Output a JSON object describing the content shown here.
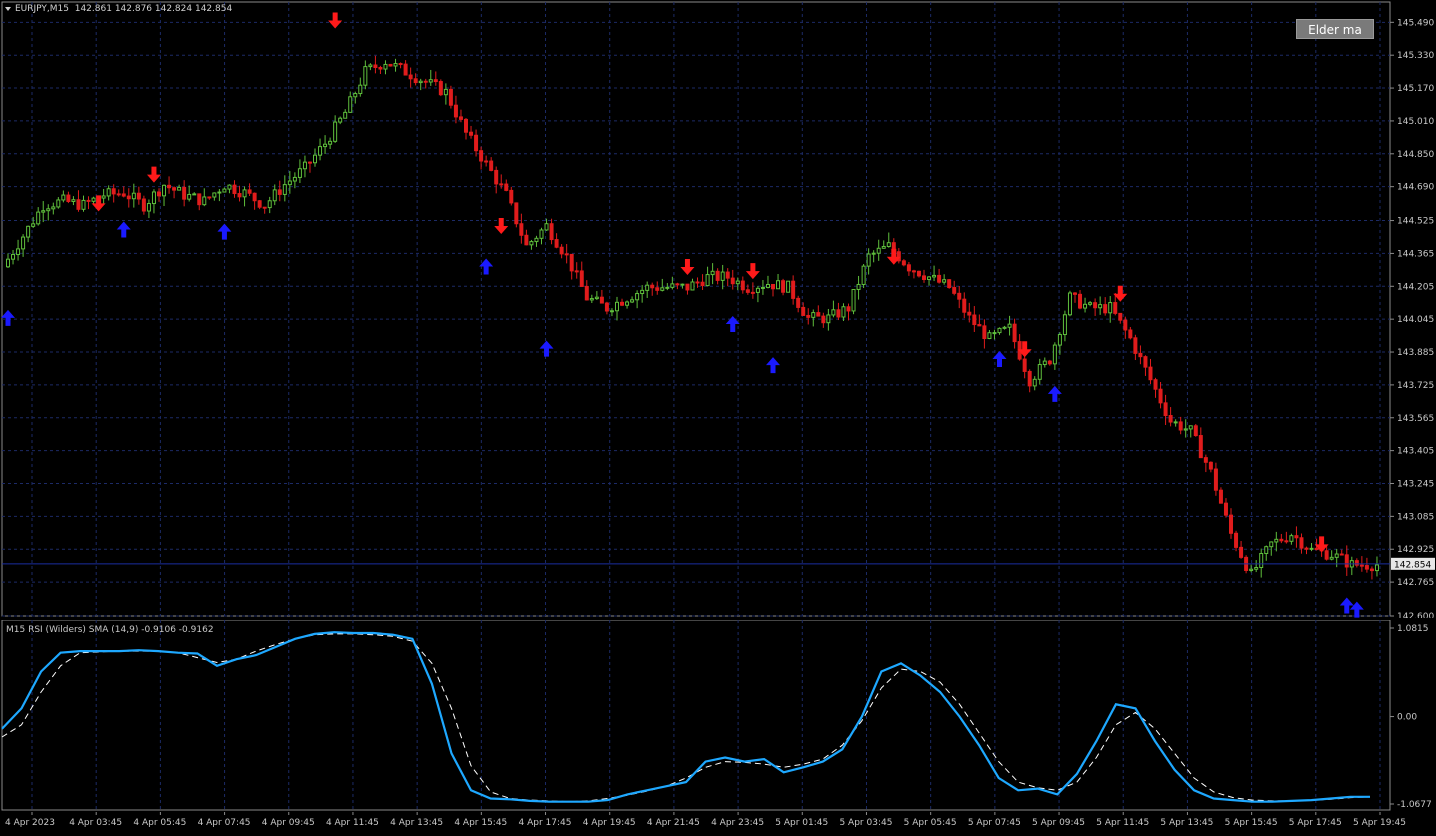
{
  "header": {
    "symbol": "EURJPY,M15",
    "ohlc": "142.861 142.876 142.824 142.854"
  },
  "button": {
    "label": "Elder ma"
  },
  "indicator": {
    "title": "M15 RSI (Wilders) SMA (14,9) -0.9106 -0.9162"
  },
  "colors": {
    "background": "#000000",
    "grid": "#1c2a66",
    "bull_candle": "#5fbf3c",
    "bear_candle": "#e01c1c",
    "buy_arrow": "#1a1aff",
    "sell_arrow": "#ff1a1a",
    "rsi_line": "#1ea8ff",
    "signal_line": "#ffffff",
    "price_line": "#1a2ea0"
  },
  "price_axis": {
    "labels": [
      "145.490",
      "145.330",
      "145.170",
      "145.010",
      "144.850",
      "144.690",
      "144.525",
      "144.365",
      "144.205",
      "144.045",
      "143.885",
      "143.725",
      "143.565",
      "143.405",
      "143.245",
      "143.085",
      "142.925",
      "142.765",
      "142.600"
    ],
    "current_price": "142.854"
  },
  "indicator_axis": {
    "labels": [
      "1.0815",
      "0.00",
      "-1.0677"
    ]
  },
  "time_axis": {
    "labels": [
      "4 Apr 2023",
      "4 Apr 03:45",
      "4 Apr 05:45",
      "4 Apr 07:45",
      "4 Apr 09:45",
      "4 Apr 11:45",
      "4 Apr 13:45",
      "4 Apr 15:45",
      "4 Apr 17:45",
      "4 Apr 19:45",
      "4 Apr 21:45",
      "4 Apr 23:45",
      "5 Apr 01:45",
      "5 Apr 03:45",
      "5 Apr 05:45",
      "5 Apr 07:45",
      "5 Apr 09:45",
      "5 Apr 11:45",
      "5 Apr 13:45",
      "5 Apr 15:45",
      "5 Apr 17:45",
      "5 Apr 19:45"
    ]
  },
  "chart_data": [
    {
      "type": "candlestick",
      "symbol": "EURJPY",
      "timeframe": "M15",
      "ylim": [
        142.6,
        145.55
      ],
      "price_line": 142.854,
      "close_path": [
        [
          0,
          144.3
        ],
        [
          4,
          144.45
        ],
        [
          8,
          144.6
        ],
        [
          12,
          144.62
        ],
        [
          16,
          144.6
        ],
        [
          20,
          144.65
        ],
        [
          24,
          144.66
        ],
        [
          28,
          144.6
        ],
        [
          32,
          144.7
        ],
        [
          36,
          144.65
        ],
        [
          40,
          144.62
        ],
        [
          44,
          144.7
        ],
        [
          48,
          144.66
        ],
        [
          52,
          144.6
        ],
        [
          56,
          144.7
        ],
        [
          60,
          144.78
        ],
        [
          64,
          144.9
        ],
        [
          68,
          145.05
        ],
        [
          72,
          145.25
        ],
        [
          76,
          145.3
        ],
        [
          80,
          145.25
        ],
        [
          84,
          145.2
        ],
        [
          88,
          145.15
        ],
        [
          92,
          144.95
        ],
        [
          96,
          144.8
        ],
        [
          100,
          144.65
        ],
        [
          104,
          144.4
        ],
        [
          108,
          144.5
        ],
        [
          112,
          144.35
        ],
        [
          116,
          144.15
        ],
        [
          120,
          144.1
        ],
        [
          124,
          144.15
        ],
        [
          128,
          144.2
        ],
        [
          132,
          144.2
        ],
        [
          136,
          144.2
        ],
        [
          140,
          144.25
        ],
        [
          144,
          144.25
        ],
        [
          148,
          144.2
        ],
        [
          152,
          144.22
        ],
        [
          156,
          144.2
        ],
        [
          160,
          144.05
        ],
        [
          164,
          144.05
        ],
        [
          168,
          144.1
        ],
        [
          172,
          144.35
        ],
        [
          176,
          144.4
        ],
        [
          180,
          144.3
        ],
        [
          184,
          144.25
        ],
        [
          188,
          144.2
        ],
        [
          192,
          144.05
        ],
        [
          196,
          143.95
        ],
        [
          200,
          144.0
        ],
        [
          204,
          143.75
        ],
        [
          208,
          143.85
        ],
        [
          212,
          144.15
        ],
        [
          216,
          144.1
        ],
        [
          220,
          144.1
        ],
        [
          224,
          143.95
        ],
        [
          228,
          143.75
        ],
        [
          232,
          143.55
        ],
        [
          236,
          143.5
        ],
        [
          240,
          143.3
        ],
        [
          244,
          143.0
        ],
        [
          248,
          142.8
        ],
        [
          252,
          142.95
        ],
        [
          256,
          143.0
        ],
        [
          260,
          142.92
        ],
        [
          264,
          142.9
        ],
        [
          268,
          142.85
        ],
        [
          272,
          142.85
        ]
      ],
      "signals": {
        "buy_bars": [
          0,
          23,
          43,
          95,
          107,
          144,
          152,
          197,
          208,
          268,
          266
        ],
        "sell_bars": [
          18,
          29,
          65,
          98,
          135,
          148,
          176,
          202,
          221,
          261
        ],
        "buy_price_levels": [
          144.1,
          144.53,
          144.52,
          144.35,
          143.95,
          144.07,
          143.87,
          143.9,
          143.73,
          142.68,
          142.7
        ],
        "sell_price_levels": [
          144.56,
          144.7,
          145.45,
          144.45,
          144.25,
          144.23,
          144.3,
          143.85,
          144.12,
          142.9
        ]
      }
    },
    {
      "type": "line",
      "title": "M15 RSI (Wilders) SMA (14,9)",
      "ylim": [
        -1.0677,
        1.0815
      ],
      "series": [
        {
          "name": "RSI (Wilders)",
          "points": [
            [
              0,
              -0.15
            ],
            [
              3,
              0.1
            ],
            [
              6,
              0.55
            ],
            [
              9,
              0.78
            ],
            [
              12,
              0.8
            ],
            [
              15,
              0.8
            ],
            [
              18,
              0.8
            ],
            [
              21,
              0.81
            ],
            [
              24,
              0.8
            ],
            [
              27,
              0.78
            ],
            [
              30,
              0.77
            ],
            [
              33,
              0.62
            ],
            [
              36,
              0.7
            ],
            [
              39,
              0.75
            ],
            [
              42,
              0.85
            ],
            [
              45,
              0.95
            ],
            [
              48,
              1.01
            ],
            [
              51,
              1.03
            ],
            [
              54,
              1.02
            ],
            [
              57,
              1.02
            ],
            [
              60,
              1.0
            ],
            [
              63,
              0.95
            ],
            [
              66,
              0.4
            ],
            [
              69,
              -0.45
            ],
            [
              72,
              -0.9
            ],
            [
              75,
              -1.0
            ],
            [
              78,
              -1.01
            ],
            [
              81,
              -1.03
            ],
            [
              84,
              -1.04
            ],
            [
              87,
              -1.04
            ],
            [
              90,
              -1.04
            ],
            [
              93,
              -1.02
            ],
            [
              96,
              -0.95
            ],
            [
              99,
              -0.9
            ],
            [
              102,
              -0.85
            ],
            [
              105,
              -0.8
            ],
            [
              108,
              -0.55
            ],
            [
              111,
              -0.5
            ],
            [
              114,
              -0.55
            ],
            [
              117,
              -0.52
            ],
            [
              120,
              -0.68
            ],
            [
              123,
              -0.62
            ],
            [
              126,
              -0.55
            ],
            [
              129,
              -0.4
            ],
            [
              132,
              0.0
            ],
            [
              135,
              0.55
            ],
            [
              138,
              0.65
            ],
            [
              141,
              0.5
            ],
            [
              144,
              0.3
            ],
            [
              147,
              0.0
            ],
            [
              150,
              -0.35
            ],
            [
              153,
              -0.75
            ],
            [
              156,
              -0.9
            ],
            [
              159,
              -0.88
            ],
            [
              162,
              -0.95
            ],
            [
              165,
              -0.7
            ],
            [
              168,
              -0.3
            ],
            [
              171,
              0.15
            ],
            [
              174,
              0.1
            ],
            [
              177,
              -0.3
            ],
            [
              180,
              -0.65
            ],
            [
              183,
              -0.9
            ],
            [
              186,
              -1.0
            ],
            [
              189,
              -1.02
            ],
            [
              192,
              -1.04
            ],
            [
              195,
              -1.04
            ],
            [
              198,
              -1.03
            ],
            [
              201,
              -1.02
            ],
            [
              204,
              -1.0
            ],
            [
              207,
              -0.98
            ],
            [
              210,
              -0.98
            ]
          ]
        },
        {
          "name": "SMA",
          "points": [
            [
              0,
              -0.25
            ],
            [
              3,
              -0.1
            ],
            [
              6,
              0.3
            ],
            [
              9,
              0.62
            ],
            [
              12,
              0.78
            ],
            [
              15,
              0.79
            ],
            [
              18,
              0.8
            ],
            [
              21,
              0.8
            ],
            [
              24,
              0.8
            ],
            [
              27,
              0.78
            ],
            [
              30,
              0.72
            ],
            [
              33,
              0.66
            ],
            [
              36,
              0.7
            ],
            [
              39,
              0.8
            ],
            [
              42,
              0.88
            ],
            [
              45,
              0.95
            ],
            [
              48,
              1.0
            ],
            [
              51,
              1.01
            ],
            [
              54,
              1.01
            ],
            [
              57,
              1.0
            ],
            [
              60,
              0.98
            ],
            [
              63,
              0.92
            ],
            [
              66,
              0.65
            ],
            [
              69,
              0.1
            ],
            [
              72,
              -0.6
            ],
            [
              75,
              -0.92
            ],
            [
              78,
              -1.0
            ],
            [
              81,
              -1.02
            ],
            [
              84,
              -1.03
            ],
            [
              87,
              -1.04
            ],
            [
              90,
              -1.03
            ],
            [
              93,
              -1.0
            ],
            [
              96,
              -0.96
            ],
            [
              99,
              -0.91
            ],
            [
              102,
              -0.85
            ],
            [
              105,
              -0.75
            ],
            [
              108,
              -0.62
            ],
            [
              111,
              -0.55
            ],
            [
              114,
              -0.56
            ],
            [
              117,
              -0.58
            ],
            [
              120,
              -0.62
            ],
            [
              123,
              -0.58
            ],
            [
              126,
              -0.52
            ],
            [
              129,
              -0.35
            ],
            [
              132,
              -0.05
            ],
            [
              135,
              0.35
            ],
            [
              138,
              0.58
            ],
            [
              141,
              0.55
            ],
            [
              144,
              0.42
            ],
            [
              147,
              0.15
            ],
            [
              150,
              -0.2
            ],
            [
              153,
              -0.55
            ],
            [
              156,
              -0.8
            ],
            [
              159,
              -0.87
            ],
            [
              162,
              -0.9
            ],
            [
              165,
              -0.8
            ],
            [
              168,
              -0.5
            ],
            [
              171,
              -0.1
            ],
            [
              174,
              0.05
            ],
            [
              177,
              -0.15
            ],
            [
              180,
              -0.45
            ],
            [
              183,
              -0.75
            ],
            [
              186,
              -0.92
            ],
            [
              189,
              -0.99
            ],
            [
              192,
              -1.02
            ],
            [
              195,
              -1.03
            ],
            [
              198,
              -1.03
            ],
            [
              201,
              -1.02
            ],
            [
              204,
              -1.01
            ],
            [
              207,
              -0.99
            ],
            [
              210,
              -0.98
            ]
          ]
        }
      ]
    }
  ]
}
